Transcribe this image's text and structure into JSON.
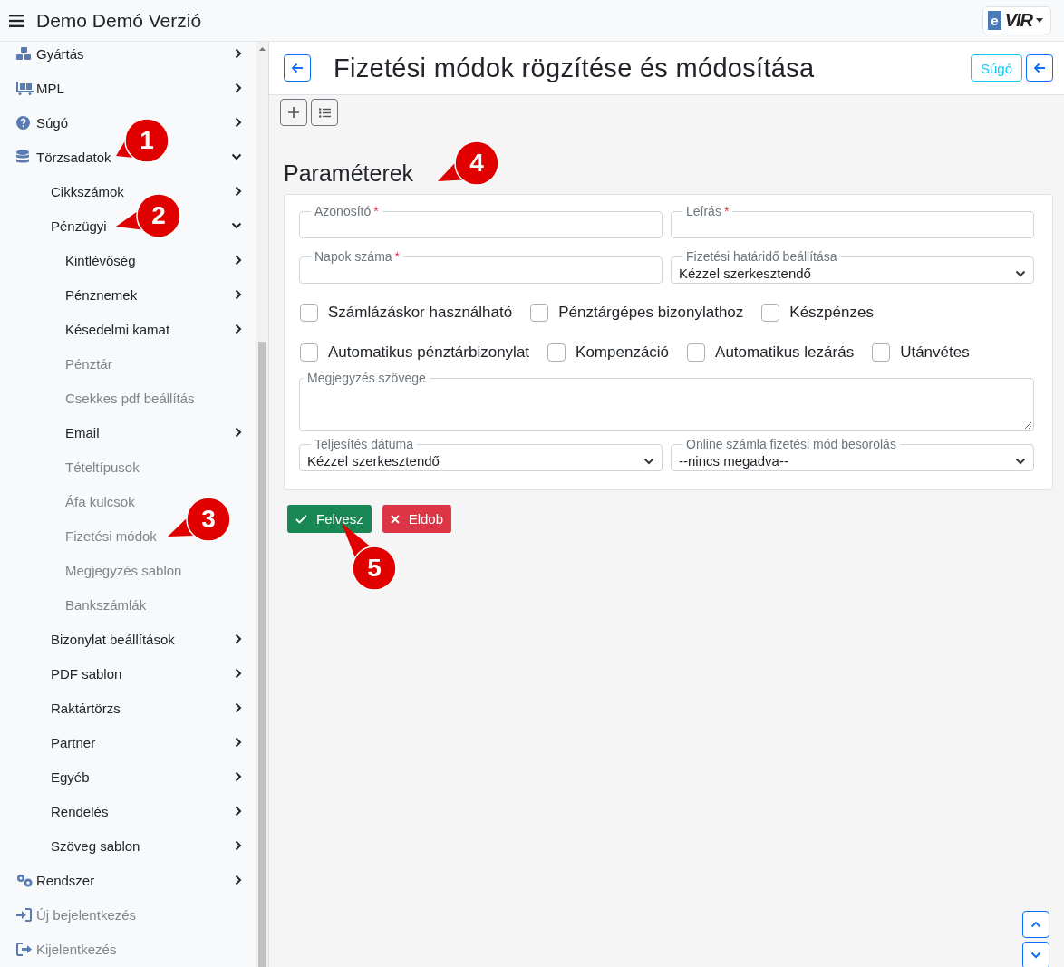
{
  "app_bar": {
    "title": "Demo Demó Verzió",
    "logo": {
      "badge": "e",
      "text": "VIR"
    }
  },
  "sidebar": {
    "items": [
      {
        "kind": "group",
        "label": "Gyártás",
        "expanded": false
      },
      {
        "kind": "group",
        "label": "MPL",
        "expanded": false
      },
      {
        "kind": "group",
        "label": "Súgó",
        "expanded": false
      },
      {
        "kind": "group",
        "label": "Törzsadatok",
        "expanded": true,
        "children": [
          {
            "kind": "group",
            "label": "Cikkszámok",
            "expanded": false
          },
          {
            "kind": "group",
            "label": "Pénzügyi",
            "expanded": true,
            "children": [
              {
                "kind": "group",
                "label": "Kintlévőség",
                "expanded": false
              },
              {
                "kind": "group",
                "label": "Pénznemek",
                "expanded": false
              },
              {
                "kind": "group",
                "label": "Késedelmi kamat",
                "expanded": false
              },
              {
                "kind": "link",
                "label": "Pénztár"
              },
              {
                "kind": "link",
                "label": "Csekkes pdf beállítás"
              },
              {
                "kind": "group",
                "label": "Email",
                "expanded": false
              },
              {
                "kind": "link",
                "label": "Tételtípusok"
              },
              {
                "kind": "link",
                "label": "Áfa kulcsok"
              },
              {
                "kind": "link",
                "label": "Fizetési módok"
              },
              {
                "kind": "link",
                "label": "Megjegyzés sablon"
              },
              {
                "kind": "link",
                "label": "Bankszámlák"
              }
            ]
          },
          {
            "kind": "group",
            "label": "Bizonylat beállítások",
            "expanded": false
          },
          {
            "kind": "group",
            "label": "PDF sablon",
            "expanded": false
          },
          {
            "kind": "group",
            "label": "Raktártörzs",
            "expanded": false
          },
          {
            "kind": "group",
            "label": "Partner",
            "expanded": false
          },
          {
            "kind": "group",
            "label": "Egyéb",
            "expanded": false
          },
          {
            "kind": "group",
            "label": "Rendelés",
            "expanded": false
          },
          {
            "kind": "group",
            "label": "Szöveg sablon",
            "expanded": false
          }
        ]
      },
      {
        "kind": "group",
        "label": "Rendszer",
        "expanded": false
      },
      {
        "kind": "link",
        "label": "Új bejelentkezés"
      },
      {
        "kind": "link",
        "label": "Kijelentkezés"
      }
    ]
  },
  "page": {
    "title": "Fizetési módok rögzítése és módosítása",
    "help_button": "Súgó"
  },
  "section_title": "Paraméterek",
  "form": {
    "fields": [
      {
        "kind": "text",
        "label": "Azonosító",
        "required_mark": "*"
      },
      {
        "kind": "text",
        "label": "Leírás",
        "required_mark": "*"
      },
      {
        "kind": "text",
        "label": "Napok száma",
        "required_mark": "*"
      },
      {
        "kind": "select",
        "label": "Fizetési határidő beállítása",
        "value": "Kézzel szerkesztendő"
      }
    ],
    "checkbox_rows": [
      [
        {
          "label": "Számlázáskor használható",
          "checked": false
        },
        {
          "label": "Pénztárgépes bizonylathoz",
          "checked": false
        },
        {
          "label": "Készpénzes",
          "checked": false
        }
      ],
      [
        {
          "label": "Automatikus pénztárbizonylat",
          "checked": false
        },
        {
          "label": "Kompenzáció",
          "checked": false
        },
        {
          "label": "Automatikus lezárás",
          "checked": false
        },
        {
          "label": "Utánvétes",
          "checked": false
        }
      ]
    ],
    "note": {
      "label": "Megjegyzés szövege"
    },
    "selects": [
      {
        "label": "Teljesítés dátuma",
        "value": "Kézzel szerkesztendő"
      },
      {
        "label": "Online számla fizetési mód besorolás",
        "value": "--nincs megadva--"
      }
    ]
  },
  "actions": [
    {
      "kind": "confirm",
      "label": "Felvesz"
    },
    {
      "kind": "discard",
      "label": "Eldob"
    }
  ],
  "callouts": [
    {
      "label": "1"
    },
    {
      "label": "2"
    },
    {
      "label": "3"
    },
    {
      "label": "4"
    },
    {
      "label": "5"
    }
  ]
}
